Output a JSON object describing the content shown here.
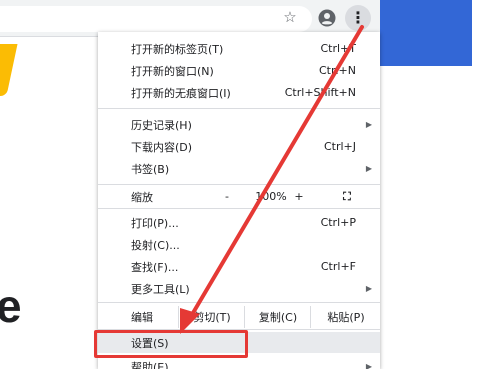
{
  "toolbar": {
    "bookmark_star": "☆",
    "menu_dots": "⋮"
  },
  "menu": {
    "items_top": [
      {
        "label": "打开新的标签页(T)",
        "shortcut": "Ctrl+T"
      },
      {
        "label": "打开新的窗口(N)",
        "shortcut": "Ctrl+N"
      },
      {
        "label": "打开新的无痕窗口(I)",
        "shortcut": "Ctrl+Shift+N"
      }
    ],
    "history": {
      "label": "历史记录(H)",
      "arrow": "▶"
    },
    "downloads": {
      "label": "下载内容(D)",
      "shortcut": "Ctrl+J"
    },
    "bookmarks": {
      "label": "书签(B)",
      "arrow": "▶"
    },
    "zoom": {
      "label": "缩放",
      "minus": "-",
      "value": "100%",
      "plus": "+",
      "fullscreen": "⛶"
    },
    "print": {
      "label": "打印(P)...",
      "shortcut": "Ctrl+P"
    },
    "cast": {
      "label": "投射(C)..."
    },
    "find": {
      "label": "查找(F)...",
      "shortcut": "Ctrl+F"
    },
    "more_tools": {
      "label": "更多工具(L)",
      "arrow": "▶"
    },
    "edit": {
      "label": "编辑",
      "cut": "剪切(T)",
      "copy": "复制(C)",
      "paste": "粘贴(P)"
    },
    "settings": {
      "label": "设置(S)"
    },
    "help": {
      "label": "帮助(E)",
      "arrow": "▶"
    }
  },
  "page": {
    "big_letter": "e"
  },
  "colors": {
    "annotation_red": "#e53935",
    "banner_blue": "#3367d6",
    "logo_yellow": "#fbbc04"
  }
}
